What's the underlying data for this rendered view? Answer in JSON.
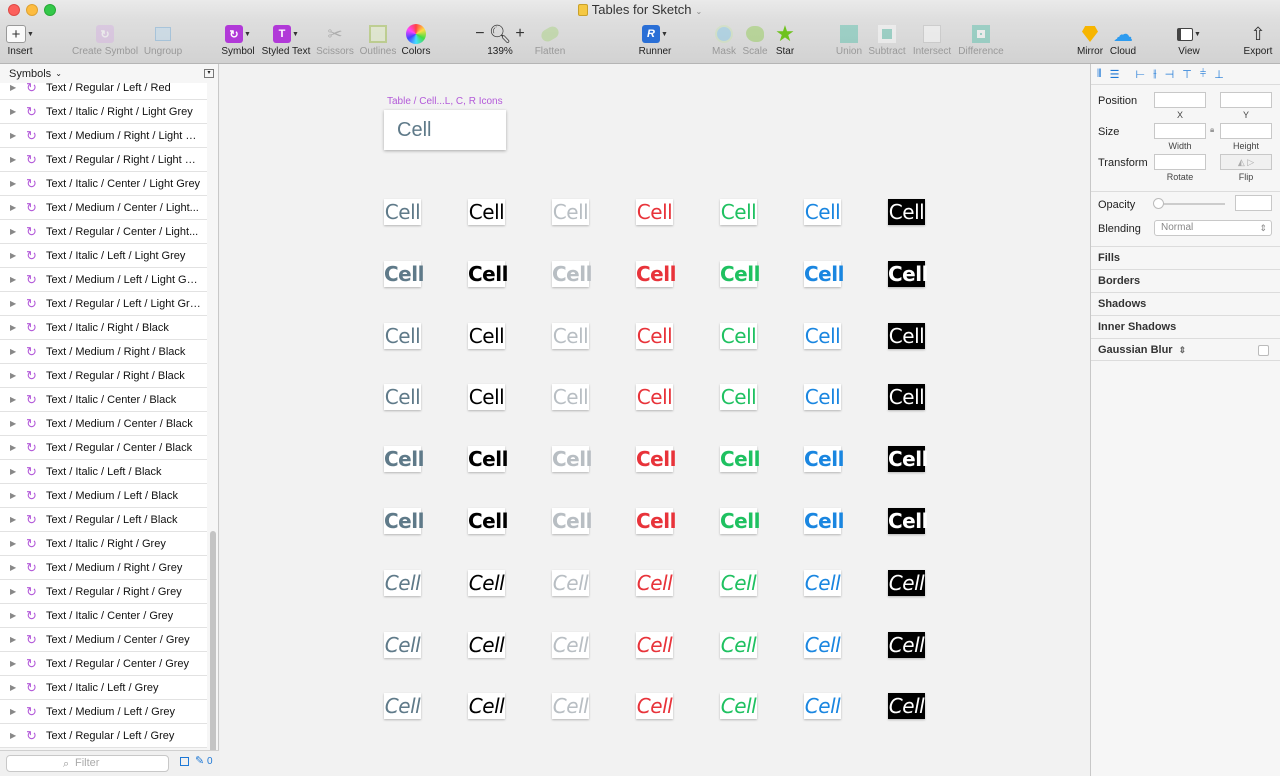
{
  "window": {
    "title": "Tables for Sketch"
  },
  "toolbar": {
    "insert": "Insert",
    "create_symbol": "Create Symbol",
    "ungroup": "Ungroup",
    "symbol": "Symbol",
    "styled_text": "Styled Text",
    "scissors": "Scissors",
    "outlines": "Outlines",
    "colors": "Colors",
    "zoom_minus": "−",
    "zoom_plus": "+",
    "zoom": "139%",
    "flatten": "Flatten",
    "runner": "Runner",
    "mask": "Mask",
    "scale": "Scale",
    "star": "Star",
    "union": "Union",
    "subtract": "Subtract",
    "intersect": "Intersect",
    "difference": "Difference",
    "mirror": "Mirror",
    "cloud": "Cloud",
    "view": "View",
    "export": "Export"
  },
  "sidebar": {
    "header": "Symbols",
    "filter_placeholder": "Filter",
    "badge": "0",
    "items": [
      "Text / Regular / Left / Red",
      "Text / Italic / Right / Light Grey",
      "Text / Medium / Right / Light G...",
      "Text / Regular / Right / Light Gr...",
      "Text / Italic / Center / Light Grey",
      "Text / Medium / Center / Light...",
      "Text / Regular / Center / Light...",
      "Text / Italic / Left / Light Grey",
      "Text / Medium / Left / Light Grey",
      "Text / Regular / Left / Light Grey",
      "Text / Italic / Right / Black",
      "Text / Medium / Right / Black",
      "Text / Regular / Right / Black",
      "Text / Italic / Center / Black",
      "Text / Medium / Center / Black",
      "Text / Regular / Center / Black",
      "Text / Italic / Left / Black",
      "Text / Medium / Left / Black",
      "Text / Regular / Left / Black",
      "Text / Italic / Right / Grey",
      "Text / Medium / Right / Grey",
      "Text / Regular / Right / Grey",
      "Text / Italic / Center / Grey",
      "Text / Medium / Center / Grey",
      "Text / Regular / Center / Grey",
      "Text / Italic / Left / Grey",
      "Text / Medium / Left / Grey",
      "Text / Regular / Left / Grey"
    ]
  },
  "canvas": {
    "artboard_label": "Table / Cell...L, C, R Icons",
    "master_cell": "Cell",
    "cell_text": "Cell",
    "colors": [
      {
        "name": "grey",
        "fg": "#5f7a89",
        "bg": "#ffffff"
      },
      {
        "name": "black",
        "fg": "#000000",
        "bg": "#ffffff"
      },
      {
        "name": "light-grey",
        "fg": "#b8bec3",
        "bg": "#ffffff"
      },
      {
        "name": "red",
        "fg": "#e8333a",
        "bg": "#ffffff"
      },
      {
        "name": "green",
        "fg": "#1fc161",
        "bg": "#ffffff"
      },
      {
        "name": "blue",
        "fg": "#1a86e0",
        "bg": "#ffffff"
      },
      {
        "name": "inverse",
        "fg": "#ffffff",
        "bg": "#000000"
      }
    ],
    "rows": [
      "regular",
      "medium",
      "regular",
      "regular",
      "medium",
      "medium",
      "italic",
      "italic",
      "italic"
    ]
  },
  "inspector": {
    "position": "Position",
    "x": "X",
    "y": "Y",
    "size": "Size",
    "width": "Width",
    "height": "Height",
    "transform": "Transform",
    "rotate": "Rotate",
    "flip": "Flip",
    "opacity": "Opacity",
    "blending": "Blending",
    "blending_value": "Normal",
    "fills": "Fills",
    "borders": "Borders",
    "shadows": "Shadows",
    "inner_shadows": "Inner Shadows",
    "gaussian_blur": "Gaussian Blur"
  }
}
